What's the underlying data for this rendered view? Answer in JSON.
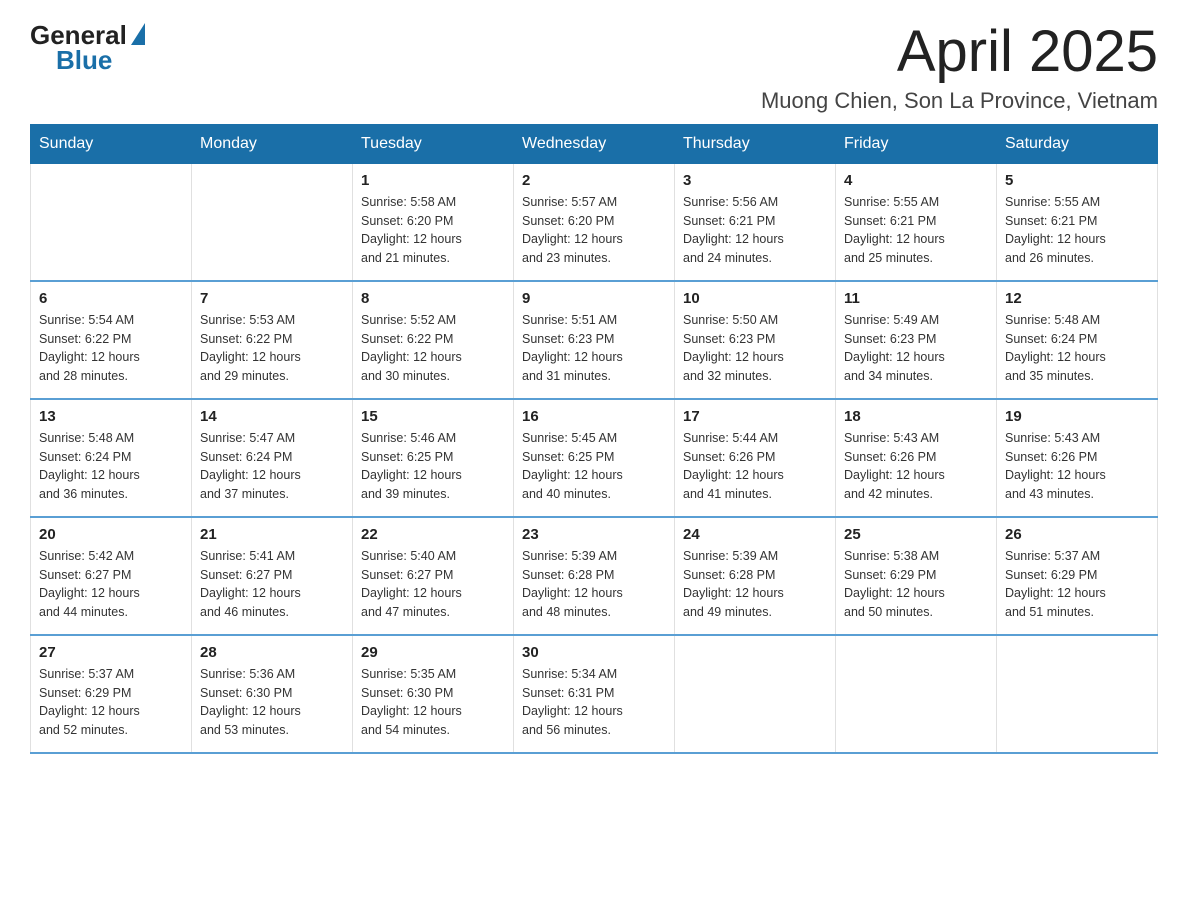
{
  "logo": {
    "general": "General",
    "blue": "Blue"
  },
  "header": {
    "month": "April 2025",
    "location": "Muong Chien, Son La Province, Vietnam"
  },
  "weekdays": [
    "Sunday",
    "Monday",
    "Tuesday",
    "Wednesday",
    "Thursday",
    "Friday",
    "Saturday"
  ],
  "weeks": [
    [
      {
        "day": "",
        "info": ""
      },
      {
        "day": "",
        "info": ""
      },
      {
        "day": "1",
        "info": "Sunrise: 5:58 AM\nSunset: 6:20 PM\nDaylight: 12 hours\nand 21 minutes."
      },
      {
        "day": "2",
        "info": "Sunrise: 5:57 AM\nSunset: 6:20 PM\nDaylight: 12 hours\nand 23 minutes."
      },
      {
        "day": "3",
        "info": "Sunrise: 5:56 AM\nSunset: 6:21 PM\nDaylight: 12 hours\nand 24 minutes."
      },
      {
        "day": "4",
        "info": "Sunrise: 5:55 AM\nSunset: 6:21 PM\nDaylight: 12 hours\nand 25 minutes."
      },
      {
        "day": "5",
        "info": "Sunrise: 5:55 AM\nSunset: 6:21 PM\nDaylight: 12 hours\nand 26 minutes."
      }
    ],
    [
      {
        "day": "6",
        "info": "Sunrise: 5:54 AM\nSunset: 6:22 PM\nDaylight: 12 hours\nand 28 minutes."
      },
      {
        "day": "7",
        "info": "Sunrise: 5:53 AM\nSunset: 6:22 PM\nDaylight: 12 hours\nand 29 minutes."
      },
      {
        "day": "8",
        "info": "Sunrise: 5:52 AM\nSunset: 6:22 PM\nDaylight: 12 hours\nand 30 minutes."
      },
      {
        "day": "9",
        "info": "Sunrise: 5:51 AM\nSunset: 6:23 PM\nDaylight: 12 hours\nand 31 minutes."
      },
      {
        "day": "10",
        "info": "Sunrise: 5:50 AM\nSunset: 6:23 PM\nDaylight: 12 hours\nand 32 minutes."
      },
      {
        "day": "11",
        "info": "Sunrise: 5:49 AM\nSunset: 6:23 PM\nDaylight: 12 hours\nand 34 minutes."
      },
      {
        "day": "12",
        "info": "Sunrise: 5:48 AM\nSunset: 6:24 PM\nDaylight: 12 hours\nand 35 minutes."
      }
    ],
    [
      {
        "day": "13",
        "info": "Sunrise: 5:48 AM\nSunset: 6:24 PM\nDaylight: 12 hours\nand 36 minutes."
      },
      {
        "day": "14",
        "info": "Sunrise: 5:47 AM\nSunset: 6:24 PM\nDaylight: 12 hours\nand 37 minutes."
      },
      {
        "day": "15",
        "info": "Sunrise: 5:46 AM\nSunset: 6:25 PM\nDaylight: 12 hours\nand 39 minutes."
      },
      {
        "day": "16",
        "info": "Sunrise: 5:45 AM\nSunset: 6:25 PM\nDaylight: 12 hours\nand 40 minutes."
      },
      {
        "day": "17",
        "info": "Sunrise: 5:44 AM\nSunset: 6:26 PM\nDaylight: 12 hours\nand 41 minutes."
      },
      {
        "day": "18",
        "info": "Sunrise: 5:43 AM\nSunset: 6:26 PM\nDaylight: 12 hours\nand 42 minutes."
      },
      {
        "day": "19",
        "info": "Sunrise: 5:43 AM\nSunset: 6:26 PM\nDaylight: 12 hours\nand 43 minutes."
      }
    ],
    [
      {
        "day": "20",
        "info": "Sunrise: 5:42 AM\nSunset: 6:27 PM\nDaylight: 12 hours\nand 44 minutes."
      },
      {
        "day": "21",
        "info": "Sunrise: 5:41 AM\nSunset: 6:27 PM\nDaylight: 12 hours\nand 46 minutes."
      },
      {
        "day": "22",
        "info": "Sunrise: 5:40 AM\nSunset: 6:27 PM\nDaylight: 12 hours\nand 47 minutes."
      },
      {
        "day": "23",
        "info": "Sunrise: 5:39 AM\nSunset: 6:28 PM\nDaylight: 12 hours\nand 48 minutes."
      },
      {
        "day": "24",
        "info": "Sunrise: 5:39 AM\nSunset: 6:28 PM\nDaylight: 12 hours\nand 49 minutes."
      },
      {
        "day": "25",
        "info": "Sunrise: 5:38 AM\nSunset: 6:29 PM\nDaylight: 12 hours\nand 50 minutes."
      },
      {
        "day": "26",
        "info": "Sunrise: 5:37 AM\nSunset: 6:29 PM\nDaylight: 12 hours\nand 51 minutes."
      }
    ],
    [
      {
        "day": "27",
        "info": "Sunrise: 5:37 AM\nSunset: 6:29 PM\nDaylight: 12 hours\nand 52 minutes."
      },
      {
        "day": "28",
        "info": "Sunrise: 5:36 AM\nSunset: 6:30 PM\nDaylight: 12 hours\nand 53 minutes."
      },
      {
        "day": "29",
        "info": "Sunrise: 5:35 AM\nSunset: 6:30 PM\nDaylight: 12 hours\nand 54 minutes."
      },
      {
        "day": "30",
        "info": "Sunrise: 5:34 AM\nSunset: 6:31 PM\nDaylight: 12 hours\nand 56 minutes."
      },
      {
        "day": "",
        "info": ""
      },
      {
        "day": "",
        "info": ""
      },
      {
        "day": "",
        "info": ""
      }
    ]
  ]
}
